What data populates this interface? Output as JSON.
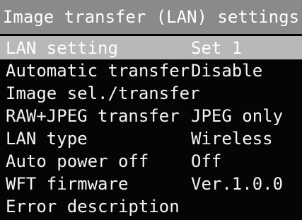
{
  "title": "Image transfer (LAN) settings",
  "colors": {
    "background": "#050505",
    "title_bar": "#8a8a8a",
    "selected_row": "#b8b8b8",
    "text": "#f4f4f4"
  },
  "menu": {
    "items": [
      {
        "label": "LAN setting",
        "value": "Set 1",
        "selected": true
      },
      {
        "label": "Automatic transfer",
        "value": "Disable",
        "selected": false
      },
      {
        "label": "Image sel./transfer",
        "value": "",
        "selected": false
      },
      {
        "label": "RAW+JPEG transfer",
        "value": "JPEG only",
        "selected": false
      },
      {
        "label": "LAN type",
        "value": "Wireless",
        "selected": false
      },
      {
        "label": "Auto power off",
        "value": "Off",
        "selected": false
      },
      {
        "label": "WFT firmware",
        "value": "Ver.1.0.0",
        "selected": false
      },
      {
        "label": "Error description",
        "value": "",
        "selected": false
      }
    ]
  }
}
